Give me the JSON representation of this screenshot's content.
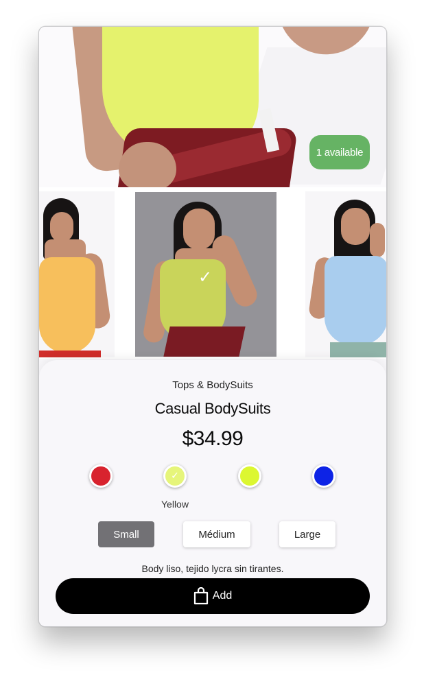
{
  "product": {
    "availability": "1 available",
    "category": "Tops & BodySuits",
    "name": "Casual BodySuits",
    "price": "$34.99",
    "selected_color_label": "Yellow",
    "description": "Body liso, tejido lycra sin tirantes.",
    "add_label": "Add"
  },
  "colors": [
    {
      "name": "red",
      "hex": "#d8232e",
      "selected": false
    },
    {
      "name": "light-yellow",
      "hex": "#e6f57a",
      "selected": true
    },
    {
      "name": "yellow",
      "hex": "#dcf731",
      "selected": false
    },
    {
      "name": "blue",
      "hex": "#0d23e6",
      "selected": false
    }
  ],
  "sizes": [
    {
      "label": "Small",
      "selected": true
    },
    {
      "label": "Médium",
      "selected": false
    },
    {
      "label": "Large",
      "selected": false
    }
  ],
  "thumbnails": [
    {
      "name": "yellow-orange-bodysuit",
      "garment_hex": "#f7bf5c"
    },
    {
      "name": "lime-bodysuit",
      "garment_hex": "#c9d45a",
      "selected": true
    },
    {
      "name": "light-blue-bodysuit",
      "garment_hex": "#a9cdee"
    }
  ],
  "icons": {
    "selected_check": "✓",
    "bag": "shopping-bag-icon"
  }
}
